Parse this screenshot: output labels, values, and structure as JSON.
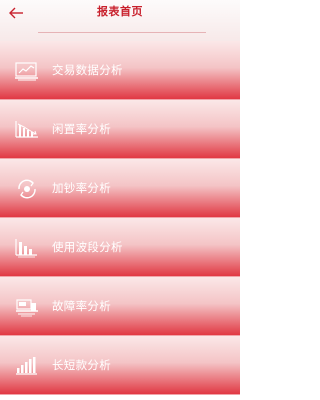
{
  "header": {
    "title": "报表首页",
    "back_icon": "back-arrow-icon"
  },
  "colors": {
    "accent": "#c8202c",
    "item_top": "#f7d6d7",
    "item_bottom": "#e0303c"
  },
  "menu": {
    "items": [
      {
        "label": "交易数据分析",
        "icon": "line-chart-icon"
      },
      {
        "label": "闲置率分析",
        "icon": "declining-bars-icon"
      },
      {
        "label": "加钞率分析",
        "icon": "refresh-cash-icon"
      },
      {
        "label": "使用波段分析",
        "icon": "bar-chart-icon"
      },
      {
        "label": "故障率分析",
        "icon": "fault-machine-icon"
      },
      {
        "label": "长短款分析",
        "icon": "bar-signal-icon"
      }
    ]
  }
}
